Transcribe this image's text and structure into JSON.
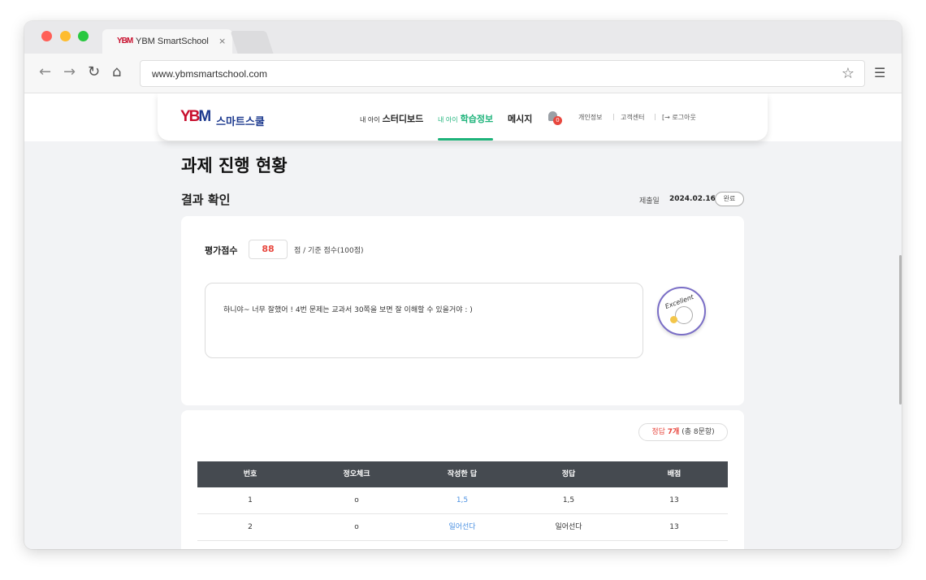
{
  "browser": {
    "tab_logo": "YBM",
    "tab_title": "YBM SmartSchool",
    "tab_close": "×",
    "url": "www.ybmsmartschool.com",
    "back": "←",
    "forward": "→",
    "reload": "↻",
    "home": "⌂",
    "star": "☆",
    "menu": "☰"
  },
  "header": {
    "logo_mark": "YB",
    "logo_mark_accent": "M",
    "logo_text": "스마트스쿨",
    "nav": [
      {
        "small": "내 아이",
        "label": "스터디보드",
        "active": false
      },
      {
        "small": "내 아이",
        "label": "학습정보",
        "active": true
      },
      {
        "small": "",
        "label": "메시지",
        "active": false
      }
    ],
    "notification_count": "0",
    "util": {
      "profile": "개인정보",
      "support": "고객센터",
      "logout": "로그아웃",
      "logout_icon": "[→",
      "separator": "|"
    }
  },
  "main": {
    "page_title": "과제 진행 현황",
    "section_title": "결과 확인",
    "submit_label": "제출일",
    "submit_date": "2024.02.16",
    "status": "완료",
    "score_label": "평가점수",
    "score": "88",
    "score_note": "점 / 기준 점수(100점)",
    "feedback": "하니야~ 너무 잘했어 ! 4번 문제는 교과서 30쪽을 보면 잘 이해할 수 있을거야 : )",
    "sticker_text": "Excellent",
    "answer_summary": {
      "prefix": "정답",
      "count": "7개",
      "total": "(총 8문항)"
    },
    "table": {
      "headers": [
        "번호",
        "정오체크",
        "작성한 답",
        "정답",
        "배점"
      ],
      "rows": [
        [
          "1",
          "o",
          "1,5",
          "1,5",
          "13"
        ],
        [
          "2",
          "o",
          "일어선다",
          "일어선다",
          "13"
        ]
      ]
    }
  }
}
